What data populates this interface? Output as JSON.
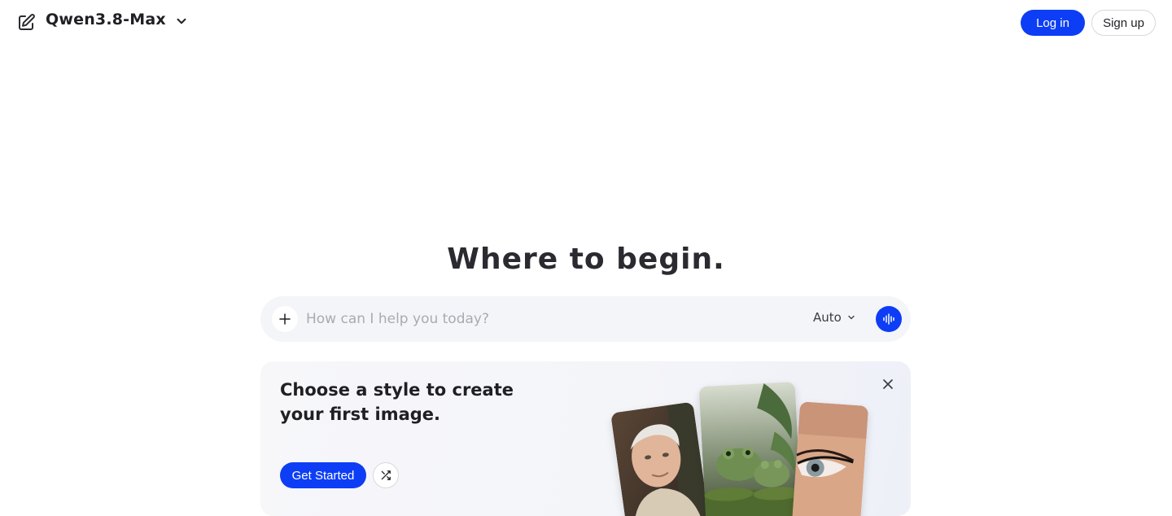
{
  "header": {
    "model_name": "Qwen3.8-Max",
    "login_label": "Log in",
    "signup_label": "Sign up",
    "accent_color": "#0d3ef5"
  },
  "main": {
    "headline": "Where to begin."
  },
  "composer": {
    "placeholder": "How can I help you today?",
    "mode_label": "Auto"
  },
  "promo_card": {
    "title_line1": "Choose a style to create",
    "title_line2": "your first image.",
    "cta_label": "Get Started",
    "images": [
      "portrait-of-older-man",
      "frogs-on-moss",
      "eye-with-eyeliner"
    ]
  },
  "icons": [
    "edit-icon",
    "chevron-down-icon",
    "plus-icon",
    "voice-wave-icon",
    "close-icon",
    "shuffle-icon"
  ]
}
